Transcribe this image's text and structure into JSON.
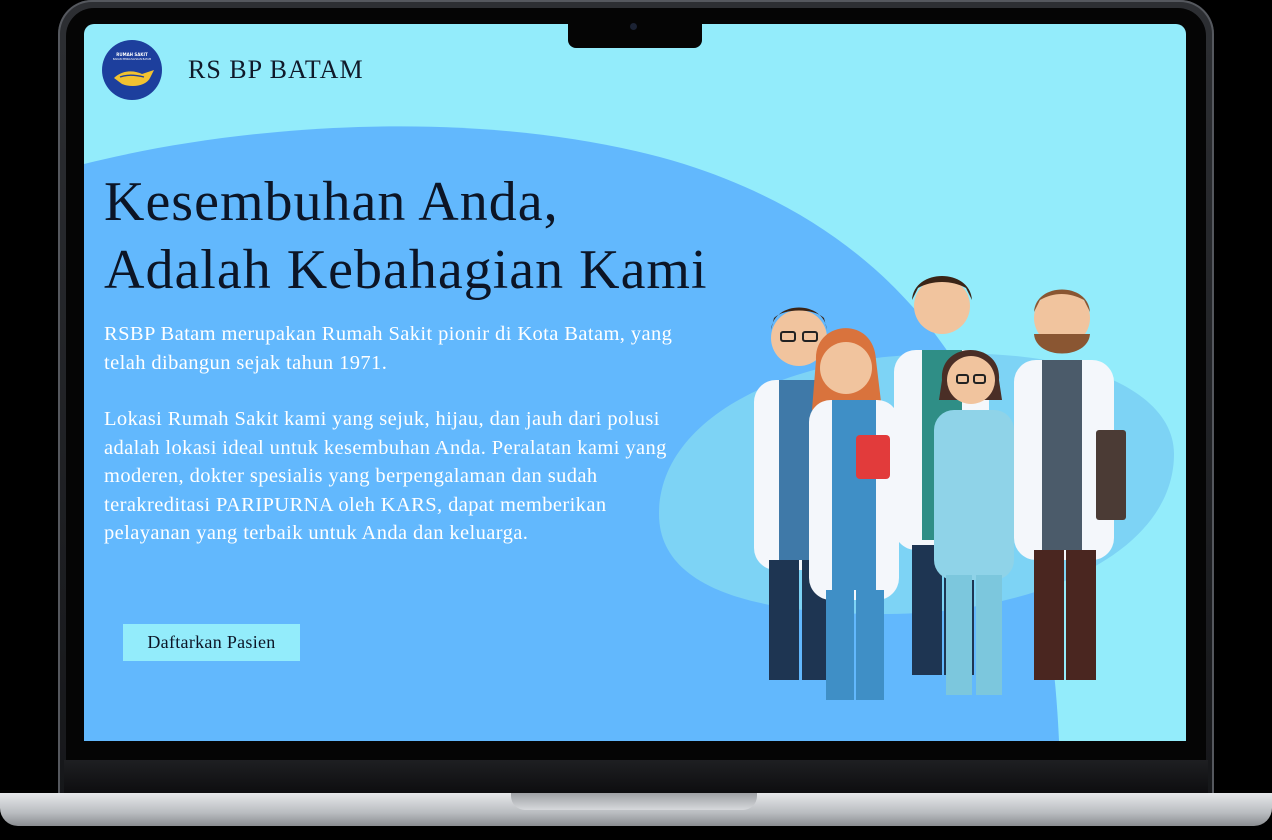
{
  "header": {
    "logo_text": "RUMAH SAKIT",
    "logo_subtext": "BADAN PENGUSAHAAN BATAM",
    "brand": "RS BP BATAM"
  },
  "hero": {
    "title_line1": "Kesembuhan Anda,",
    "title_line2": "Adalah Kebahagian Kami",
    "paragraph1": "RSBP Batam merupakan Rumah Sakit pionir di Kota Batam, yang telah dibangun sejak tahun 1971.",
    "paragraph2": "Lokasi Rumah Sakit kami yang sejuk, hijau, dan jauh dari polusi adalah lokasi ideal untuk kesembuhan Anda. Peralatan kami yang moderen, dokter spesialis yang berpengalaman dan sudah terakreditasi PARIPURNA oleh KARS, dapat memberikan pelayanan yang terbaik untuk Anda dan keluarga.",
    "cta_label": "Daftarkan Pasien"
  },
  "illustration": {
    "icon": "doctors-team-icon"
  },
  "colors": {
    "screen_bg": "#93ecfb",
    "hero_blob": "#62b8fd",
    "accent_blob": "#7dd3f5",
    "title_text": "#0c1526",
    "body_text": "#ffffff",
    "logo_blue": "#1d3f9d",
    "logo_gold": "#f2c230"
  }
}
